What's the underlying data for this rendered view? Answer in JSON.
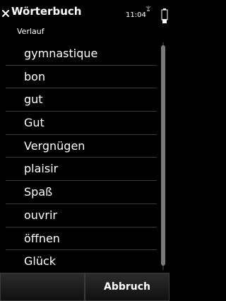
{
  "statusbar": {
    "title": "Wörterbuch",
    "time": "11:04"
  },
  "history": {
    "label": "Verlauf",
    "items": [
      {
        "label": "gymnastique"
      },
      {
        "label": "bon"
      },
      {
        "label": "gut"
      },
      {
        "label": "Gut"
      },
      {
        "label": "Vergnügen"
      },
      {
        "label": "plaisir"
      },
      {
        "label": "Spaß"
      },
      {
        "label": "ouvrir"
      },
      {
        "label": "öffnen"
      },
      {
        "label": "Glück"
      }
    ]
  },
  "softkeys": {
    "left_label": "",
    "right_label": "Abbruch"
  },
  "icons": {
    "close": "close-icon",
    "signal": "signal-icon",
    "battery": "battery-icon"
  },
  "colors": {
    "background": "#000000",
    "text": "#ffffff",
    "divider": "#3a3a3a",
    "scroll_thumb": "#7a7a7a"
  }
}
